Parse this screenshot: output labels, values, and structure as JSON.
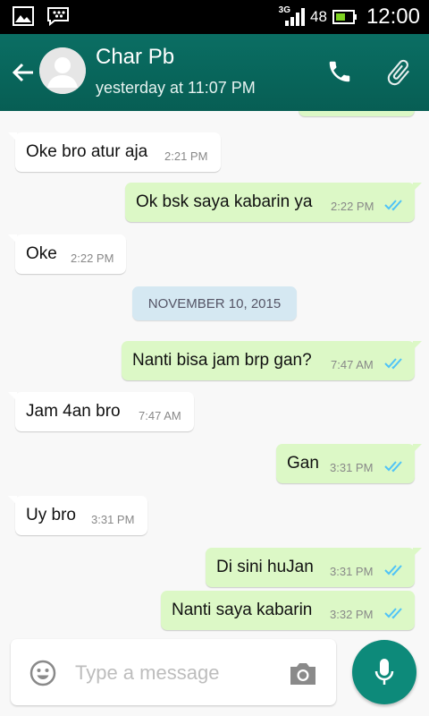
{
  "status_bar": {
    "network": "3G",
    "battery_level": "48",
    "time": "12:00"
  },
  "header": {
    "contact_name": "Char Pb",
    "last_seen": "yesterday at 11:07 PM",
    "icons": [
      "back-arrow-icon",
      "avatar-placeholder-icon",
      "phone-icon",
      "paperclip-icon"
    ]
  },
  "messages": [
    {
      "direction": "in",
      "text": "Oke bro atur aja",
      "time": "2:21 PM"
    },
    {
      "direction": "out",
      "text": "Ok bsk saya kabarin ya",
      "time": "2:22 PM",
      "status": "read"
    },
    {
      "direction": "in",
      "text": "Oke",
      "time": "2:22 PM"
    },
    {
      "direction": "out",
      "text": "Nanti bisa jam brp gan?",
      "time": "7:47 AM",
      "status": "read"
    },
    {
      "direction": "in",
      "text": "Jam 4an bro",
      "time": "7:47 AM"
    },
    {
      "direction": "out",
      "text": "Gan",
      "time": "3:31 PM",
      "status": "read"
    },
    {
      "direction": "in",
      "text": "Uy bro",
      "time": "3:31 PM"
    },
    {
      "direction": "out",
      "text": "Di sini huJan",
      "time": "3:31 PM",
      "status": "read"
    },
    {
      "direction": "out",
      "text": "Nanti saya kabarin",
      "time": "3:32 PM",
      "status": "read"
    }
  ],
  "date_divider": "NOVEMBER 10, 2015",
  "composer": {
    "placeholder": "Type a message",
    "icons": [
      "emoji-icon",
      "camera-icon",
      "mic-icon"
    ]
  },
  "colors": {
    "header": "#075e54",
    "outgoing_bubble": "#dcf8c6",
    "incoming_bubble": "#ffffff",
    "read_ticks": "#4fc3f7",
    "mic_button": "#0d8a7a",
    "date_chip": "#d5e8f2"
  }
}
